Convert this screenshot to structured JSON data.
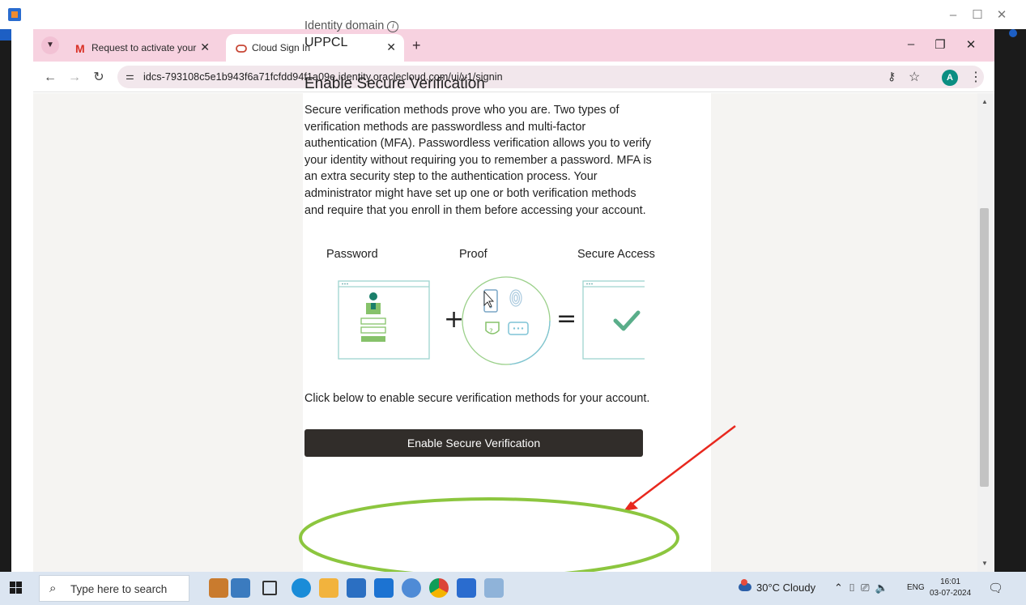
{
  "browser": {
    "tabs": [
      {
        "label": "Request to activate your user ID",
        "favicon": "gmail-icon"
      },
      {
        "label": "Cloud Sign In",
        "favicon": "oracle-icon"
      }
    ],
    "url": "idcs-793108c5e1b943f6a71fcfdd94f1a09e.identity.oraclecloud.com/ui/v1/signin",
    "profile_initial": "A"
  },
  "page": {
    "identity_domain_label": "Identity domain",
    "identity_domain_value": "UPPCL",
    "heading": "Enable Secure Verification",
    "description": "Secure verification methods prove who you are. Two types of verification methods are passwordless and multi-factor authentication (MFA). Passwordless verification allows you to verify your identity without requiring you to remember a password. MFA is an extra security step to the authentication process. Your administrator might have set up one or both verification methods and require that you enroll in them before accessing your account.",
    "illustration": {
      "password_label": "Password",
      "proof_label": "Proof",
      "access_label": "Secure Access"
    },
    "footer_text": "Click below to enable secure verification methods for your account.",
    "button_label": "Enable Secure Verification"
  },
  "annotation": {
    "arrow_color": "#e8281e",
    "ellipse_color": "#8cc63f"
  },
  "taskbar": {
    "search_placeholder": "Type here to search",
    "weather": "30°C  Cloudy",
    "language": "ENG",
    "time": "16:01",
    "date": "03-07-2024"
  }
}
